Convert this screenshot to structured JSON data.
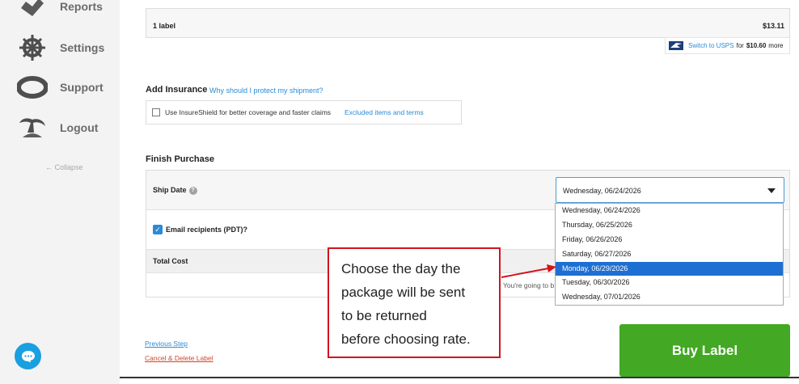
{
  "sidebar": {
    "items": [
      {
        "label": "Reports",
        "icon": "reports-icon"
      },
      {
        "label": "Settings",
        "icon": "ship-wheel-icon"
      },
      {
        "label": "Support",
        "icon": "life-ring-icon"
      },
      {
        "label": "Logout",
        "icon": "island-icon"
      }
    ],
    "collapse": "← Collapse"
  },
  "label_summary": {
    "count": "1 label",
    "price": "$13.11"
  },
  "usps": {
    "link": "Switch to USPS",
    "suffix_for": "for",
    "price": "$10.60",
    "suffix_more": "more"
  },
  "insurance": {
    "title": "Add Insurance",
    "help_link": "Why should I protect my shipment?",
    "option": "Use InsureShield for better coverage and faster claims",
    "excluded_link": "Excluded items and terms"
  },
  "finish": {
    "title": "Finish Purchase",
    "ship_date_label": "Ship Date",
    "ship_date_value": "Wednesday, 06/24/2026",
    "email_label": "Email recipients (PDT)?",
    "total_label": "Total Cost",
    "going_text": "You're going to b"
  },
  "dropdown": {
    "options": [
      "Wednesday, 06/24/2026",
      "Thursday, 06/25/2026",
      "Friday, 06/26/2026",
      "Saturday, 06/27/2026",
      "Monday, 06/29/2026",
      "Tuesday, 06/30/2026",
      "Wednesday, 07/01/2026"
    ],
    "selected": "Monday, 06/29/2026"
  },
  "footer": {
    "previous": "Previous Step",
    "cancel": "Cancel & Delete Label",
    "buy": "Buy Label"
  },
  "annotation": {
    "lines": [
      "Choose the day the",
      "package will be sent",
      "to be returned",
      "before choosing rate."
    ]
  },
  "colors": {
    "accent": "#2a8bd6",
    "buy": "#43a823",
    "selected": "#1e6fd2",
    "callout": "#d3141c"
  }
}
